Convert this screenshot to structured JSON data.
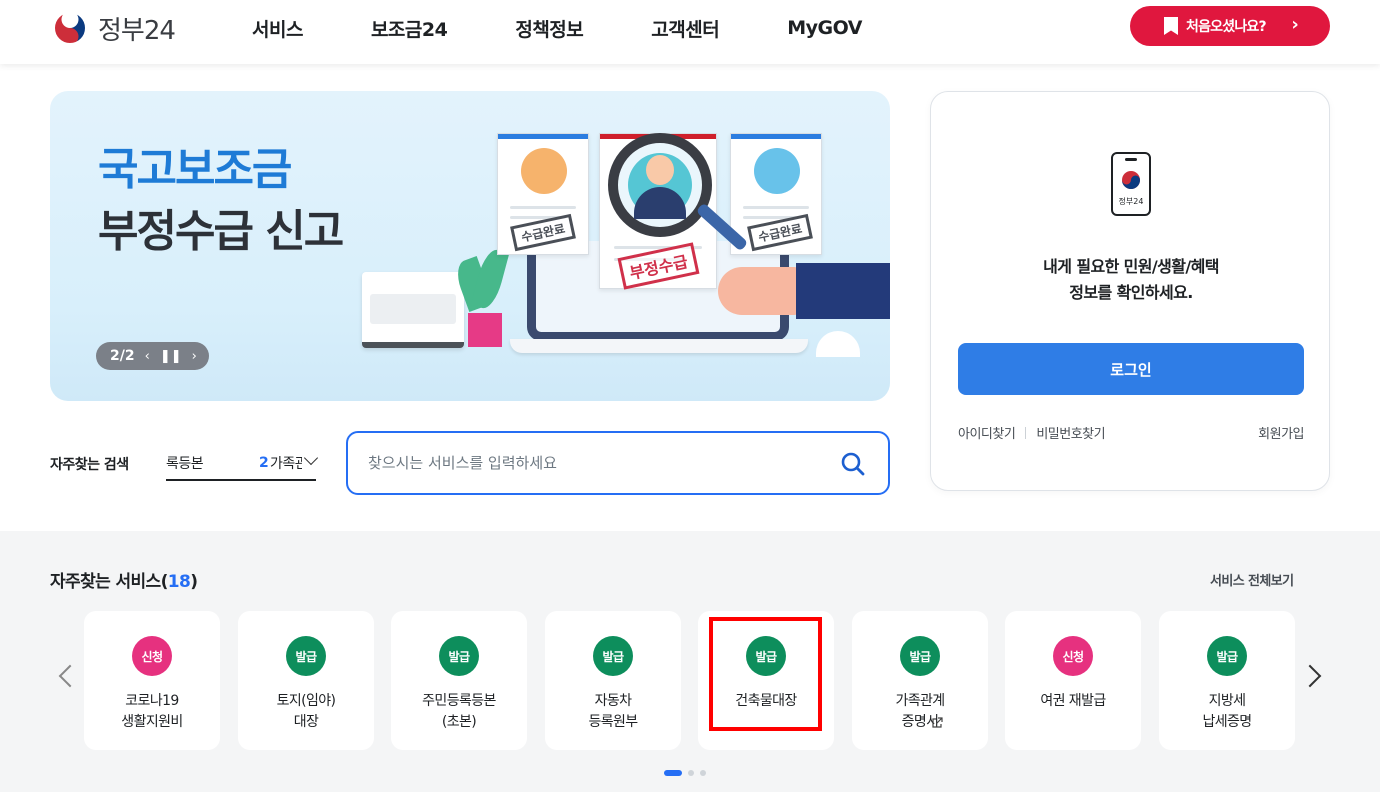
{
  "header": {
    "logo_text": "정부24",
    "nav": [
      "서비스",
      "보조금24",
      "정책정보",
      "고객센터",
      "MyGOV"
    ],
    "first_visit_label": "처음오셨나요?"
  },
  "banner": {
    "title_line1": "국고보조금",
    "title_line2": "부정수급 신고",
    "pager": "2/2",
    "stamp_small": "수급완료",
    "stamp_main": "부정수급"
  },
  "search": {
    "label": "자주찾는 검색",
    "keyword_primary": "록등본",
    "keyword_rank": "2",
    "keyword_secondary": "가족관계",
    "placeholder": "찾으시는 서비스를 입력하세요"
  },
  "login": {
    "phone_label": "정부24",
    "message_line1": "내게 필요한 민원/생활/혜택",
    "message_line2": "정보를 확인하세요.",
    "button": "로그인",
    "find_id": "아이디찾기",
    "find_password": "비밀번호찾기",
    "join": "회원가입"
  },
  "services": {
    "title": "자주찾는 서비스",
    "count": "18",
    "view_all": "서비스 전체보기",
    "items": [
      {
        "badge": "신청",
        "badge_color": "#e6317f",
        "name": "코로나19\n생활지원비"
      },
      {
        "badge": "발급",
        "badge_color": "#0d8e5c",
        "name": "토지(임야)\n대장"
      },
      {
        "badge": "발급",
        "badge_color": "#0d8e5c",
        "name": "주민등록등본\n(초본)"
      },
      {
        "badge": "발급",
        "badge_color": "#0d8e5c",
        "name": "자동차\n등록원부"
      },
      {
        "badge": "발급",
        "badge_color": "#0d8e5c",
        "name": "건축물대장"
      },
      {
        "badge": "발급",
        "badge_color": "#0d8e5c",
        "name": "가족관계\n증명서"
      },
      {
        "badge": "신청",
        "badge_color": "#e6317f",
        "name": "여권 재발급"
      },
      {
        "badge": "발급",
        "badge_color": "#0d8e5c",
        "name": "지방세\n납세증명"
      }
    ],
    "page_count": 3,
    "active_page": 1
  },
  "colors": {
    "accent_blue": "#256ef4",
    "login_blue": "#2f7de6",
    "red": "#e0173e"
  }
}
